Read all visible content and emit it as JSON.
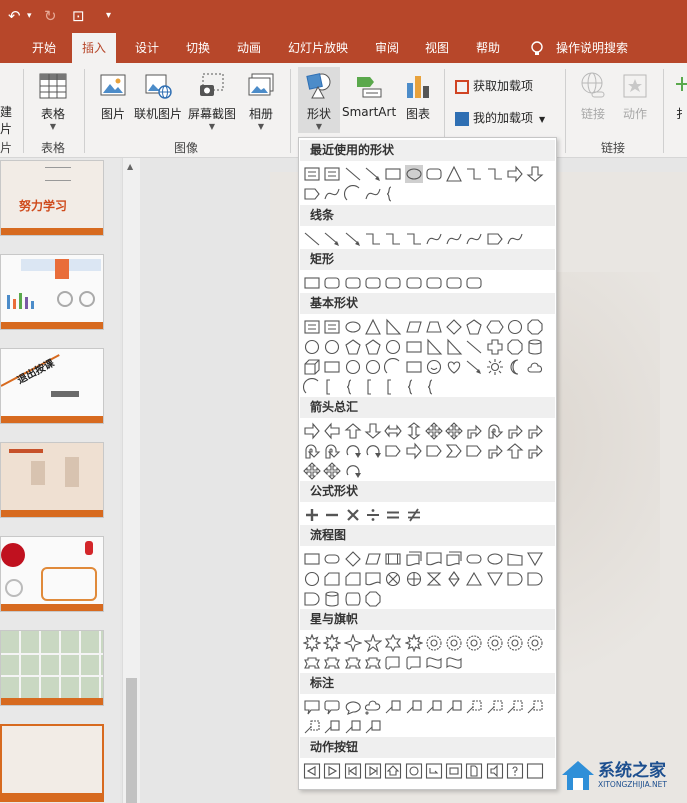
{
  "qat": {
    "undo_icon": "↶",
    "undo_caret": "▾",
    "redo_icon": "↻",
    "present_icon": "⊡",
    "customize_icon": "▾"
  },
  "tabs": [
    "开始",
    "插入",
    "设计",
    "切换",
    "动画",
    "幻灯片放映",
    "审阅",
    "视图",
    "帮助"
  ],
  "active_tab": "插入",
  "tell_me": "操作说明搜索",
  "ribbon": {
    "partial_left": {
      "line1": "建",
      "line2": "片",
      "group": "片"
    },
    "table": {
      "label": "表格",
      "group": "表格"
    },
    "picture": "图片",
    "online_picture": "联机图片",
    "screenshot": "屏幕截图",
    "album": "相册",
    "images_group": "图像",
    "shapes": "形状",
    "smartart": "SmartArt",
    "chart": "图表",
    "get_addins": "获取加载项",
    "my_addins": "我的加载项",
    "link": "链接",
    "action": "动作",
    "links_group": "链接",
    "partial_right": "扌"
  },
  "dropdown": {
    "sections": [
      "最近使用的形状",
      "线条",
      "矩形",
      "基本形状",
      "箭头总汇",
      "公式形状",
      "流程图",
      "星与旗帜",
      "标注",
      "动作按钮"
    ]
  },
  "thumbs": [
    "努力学习",
    "退出按课",
    ""
  ],
  "watermark": {
    "title": "系统之家",
    "url": "XITONGZHIJIA.NET"
  },
  "colors": {
    "accent": "#b7472a",
    "ribbon_bg": "#f3f2f1",
    "slide_orange": "#d76a1f"
  }
}
